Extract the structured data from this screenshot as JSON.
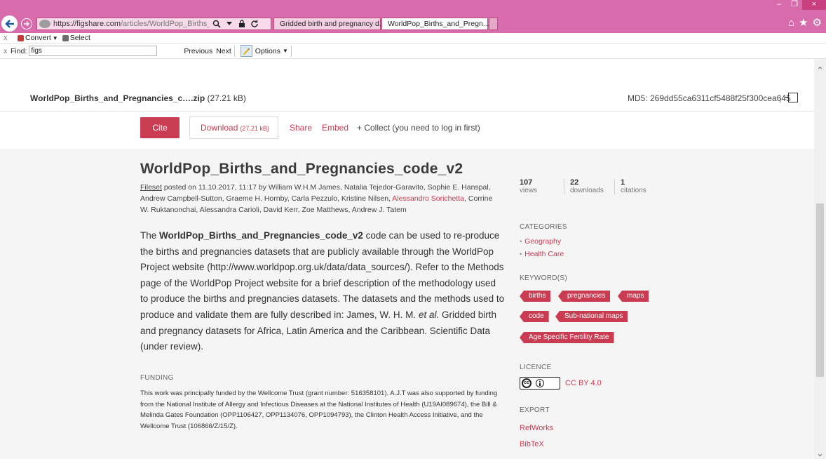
{
  "browser": {
    "url_host": "https://figshare.com",
    "url_path": "/articles/WorldPop_Births_and_Pregnar",
    "tabs": [
      {
        "label": "Gridded birth and pregnancy d...",
        "active": false
      },
      {
        "label": "WorldPop_Births_and_Pregn...",
        "active": true
      }
    ],
    "close_glyph": "×",
    "accent_color": "#d86bab"
  },
  "command_bar": {
    "close_glyph": "x",
    "convert_label": "Convert",
    "select_label": "Select"
  },
  "find_bar": {
    "close_glyph": "x",
    "label": "Find:",
    "value": "figs",
    "previous_label": "Previous",
    "next_label": "Next",
    "options_label": "Options"
  },
  "file": {
    "name": "WorldPop_Births_and_Pregnancies_c….zip",
    "size": "(27.21 kB)",
    "md5": "MD5: 269dd55ca6311cf5488f25f300cea645",
    "separator": "|"
  },
  "actions": {
    "cite": "Cite",
    "download": "Download",
    "download_size": "(27.21 kB)",
    "share": "Share",
    "embed": "Embed",
    "collect": "+ Collect (you need to log in first)"
  },
  "article": {
    "title": "WorldPop_Births_and_Pregnancies_code_v2",
    "fileset_label": "Fileset",
    "posted_text": " posted on 11.10.2017, 11:17 by  William W.H.M James,  Natalia Tejedor-Garavito,  Sophie E. Hanspal,  Andrew Campbell-Sutton,  Graeme H. Hornby,  Carla Pezzulo,  Kristine Nilsen,  ",
    "highlighted_author": "Alessandro Sorichetta",
    "posted_text_end": ",  Corrine W. Ruktanonchai,  Alessandra Carioli,  David Kerr,  Zoe Matthews,  Andrew J. Tatem",
    "desc_prefix": "The ",
    "desc_bold": "WorldPop_Births_and_Pregnancies_code_v2",
    "desc_body": " code can be used to re-produce the births and pregnancies datasets that are publicly available through the WorldPop Project website (http://www.worldpop.org.uk/data/data_sources/). Refer to the Methods page of the WorldPop Project website for a brief description of the methodology used to produce the births and pregnancies datasets. The datasets and the methods used to produce and validate them are fully described in: James, W. H. M. ",
    "desc_italic": "et al.",
    "desc_end": " Gridded birth and pregnancy datasets for Africa, Latin America and the Caribbean. Scientific Data (under review).",
    "funding_heading": "FUNDING",
    "funding_text": "This work was principally funded by the Wellcome Trust (grant number: 516358101). A.J.T was also supported by funding from the National Institute of Allergy and Infectious Diseases at the National Institutes of Health (U19AI089674), the Bill & Melinda Gates Foundation (OPP1106427, OPP1134076, OPP1094793), the Clinton Health Access Initiative, and the Wellcome Trust (106866/Z/15/Z)."
  },
  "sidebar": {
    "stats": [
      {
        "value": "107",
        "label": "views"
      },
      {
        "value": "22",
        "label": "downloads"
      },
      {
        "value": "1",
        "label": "citations"
      }
    ],
    "categories_heading": "CATEGORIES",
    "categories": [
      "Geography",
      "Health Care"
    ],
    "keywords_heading": "KEYWORD(S)",
    "keywords": [
      "births",
      "pregnancies",
      "maps",
      "code",
      "Sub-national maps",
      "Age Specific Fertility Rate"
    ],
    "licence_heading": "LICENCE",
    "licence_badge_text": "cc",
    "licence": "CC BY 4.0",
    "export_heading": "EXPORT",
    "export_links": [
      "RefWorks",
      "BibTeX"
    ],
    "brand_color": "#c93c52"
  }
}
